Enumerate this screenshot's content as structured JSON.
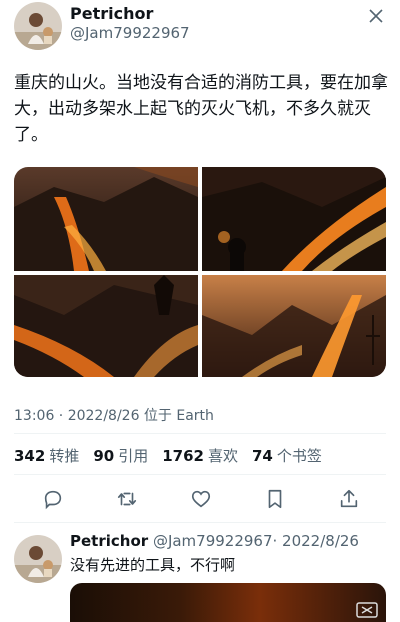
{
  "tweet": {
    "author_name": "Petrichor",
    "author_handle": "@Jam79922967",
    "text": "重庆的山火。当地没有合适的消防工具，要在加拿大，出动多架水上起飞的灭火飞机，不多久就灭了。",
    "meta": "13:06 · 2022/8/26 位于 Earth"
  },
  "stats": [
    {
      "value": "342",
      "label": "转推"
    },
    {
      "value": "90",
      "label": "引用"
    },
    {
      "value": "1762",
      "label": "喜欢"
    },
    {
      "value": "74",
      "label": "个书签"
    }
  ],
  "reply": {
    "author_name": "Petrichor",
    "author_handle": "@Jam79922967",
    "date": "· 2022/8/26",
    "text": "没有先进的工具，不行啊"
  },
  "icons": {
    "reply": "reply-icon",
    "retweet": "retweet-icon",
    "like": "heart-icon",
    "bookmark": "bookmark-icon",
    "share": "share-icon"
  },
  "colors": {
    "text": "#0f1419",
    "secondary": "#536471",
    "divider": "#eff3f4"
  }
}
